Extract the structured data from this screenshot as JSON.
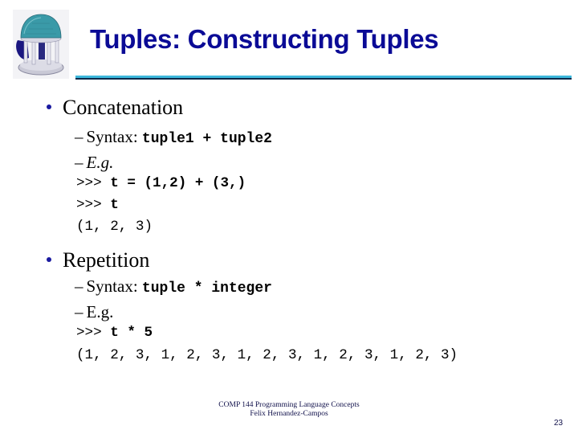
{
  "slide": {
    "title": "Tuples: Constructing Tuples",
    "logo_icon": "old-well-rotunda-icon",
    "colors": {
      "title": "#0b0b96",
      "rule": "#3db8dc",
      "rule_shadow": "#0b2a4a",
      "bullet": "#1a1aa0",
      "footer": "#10104a"
    }
  },
  "sections": [
    {
      "heading": "Concatenation",
      "syntax_label": "Syntax:",
      "syntax_code": "tuple1 + tuple2",
      "example_label": "E.g.",
      "example_italic": true,
      "code_lines": [
        {
          "prompt": ">>> ",
          "input": "t = (1,2) + (3,)"
        },
        {
          "prompt": ">>> ",
          "input": "t"
        },
        {
          "output": "(1, 2, 3)"
        }
      ]
    },
    {
      "heading": "Repetition",
      "syntax_label": "Syntax:",
      "syntax_code": "tuple * integer",
      "example_label": "E.g.",
      "example_italic": false,
      "code_lines": [
        {
          "prompt": ">>> ",
          "input": "t * 5"
        },
        {
          "output": "(1, 2, 3, 1, 2, 3, 1, 2, 3, 1, 2, 3, 1, 2, 3)"
        }
      ]
    }
  ],
  "footer": {
    "course": "COMP 144 Programming Language Concepts",
    "author": "Felix Hernandez-Campos"
  },
  "page_number": "23"
}
